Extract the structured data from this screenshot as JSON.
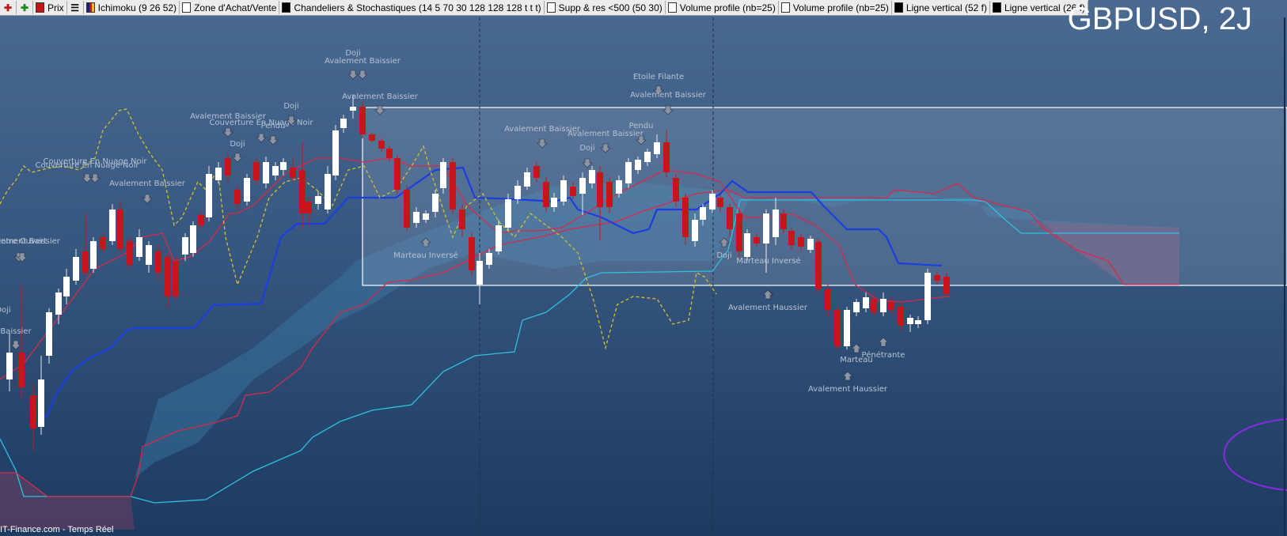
{
  "toolbar": {
    "items": [
      {
        "label": "Prix",
        "swatch": "red"
      },
      {
        "label": "Ichimoku (9 26 52)",
        "swatch": "multi"
      },
      {
        "label": "Zone d'Achat/Vente",
        "swatch": "empty"
      },
      {
        "label": "Chandeliers & Stochastiques (14 5 70 30 128 128 128 t t t)",
        "swatch": "black"
      },
      {
        "label": "Supp & res <500 (50 30)",
        "swatch": "empty"
      },
      {
        "label": "Volume profile (nb=25)",
        "swatch": "empty"
      },
      {
        "label": "Volume profile (nb=25)",
        "swatch": "empty"
      },
      {
        "label": "Ligne vertical (52 f)",
        "swatch": "black"
      },
      {
        "label": "Ligne vertical (26 f)",
        "swatch": "black"
      }
    ]
  },
  "symbol_title": "GBPUSD, 2J",
  "footer_credit": "IT-Finance.com - Temps Réel",
  "colors": {
    "bull_candle": "#ffffff",
    "bear_candle": "#c8151b",
    "kijun": "#1a3ee0",
    "tenkan": "#d8294a",
    "chikou": "#d9c228",
    "ssa": "#d8294a",
    "ssb": "#2ec0e0"
  },
  "annotations": [
    "Doji",
    "Avalement Baissier",
    "Avalement Baissier",
    "Avalement Baissier",
    "Couverture En Nuage Noir",
    "Pendu",
    "Doji",
    "Doji",
    "Couverture En Nuage Noir",
    "Couverture En Nuage Noir",
    "Avalement Baissier",
    "Ventre Ouvert",
    "Avalement Baissier",
    "Doji",
    "Baissier",
    "Marteau Inversé",
    "Avalement Baissier",
    "Avalement Baissier",
    "Pendu",
    "Doji",
    "Etoile Filante",
    "Avalement Baissier",
    "Doji",
    "Marteau Inversé",
    "Avalement Haussier",
    "Marteau",
    "Pénétrante",
    "Avalement Haussier"
  ]
}
